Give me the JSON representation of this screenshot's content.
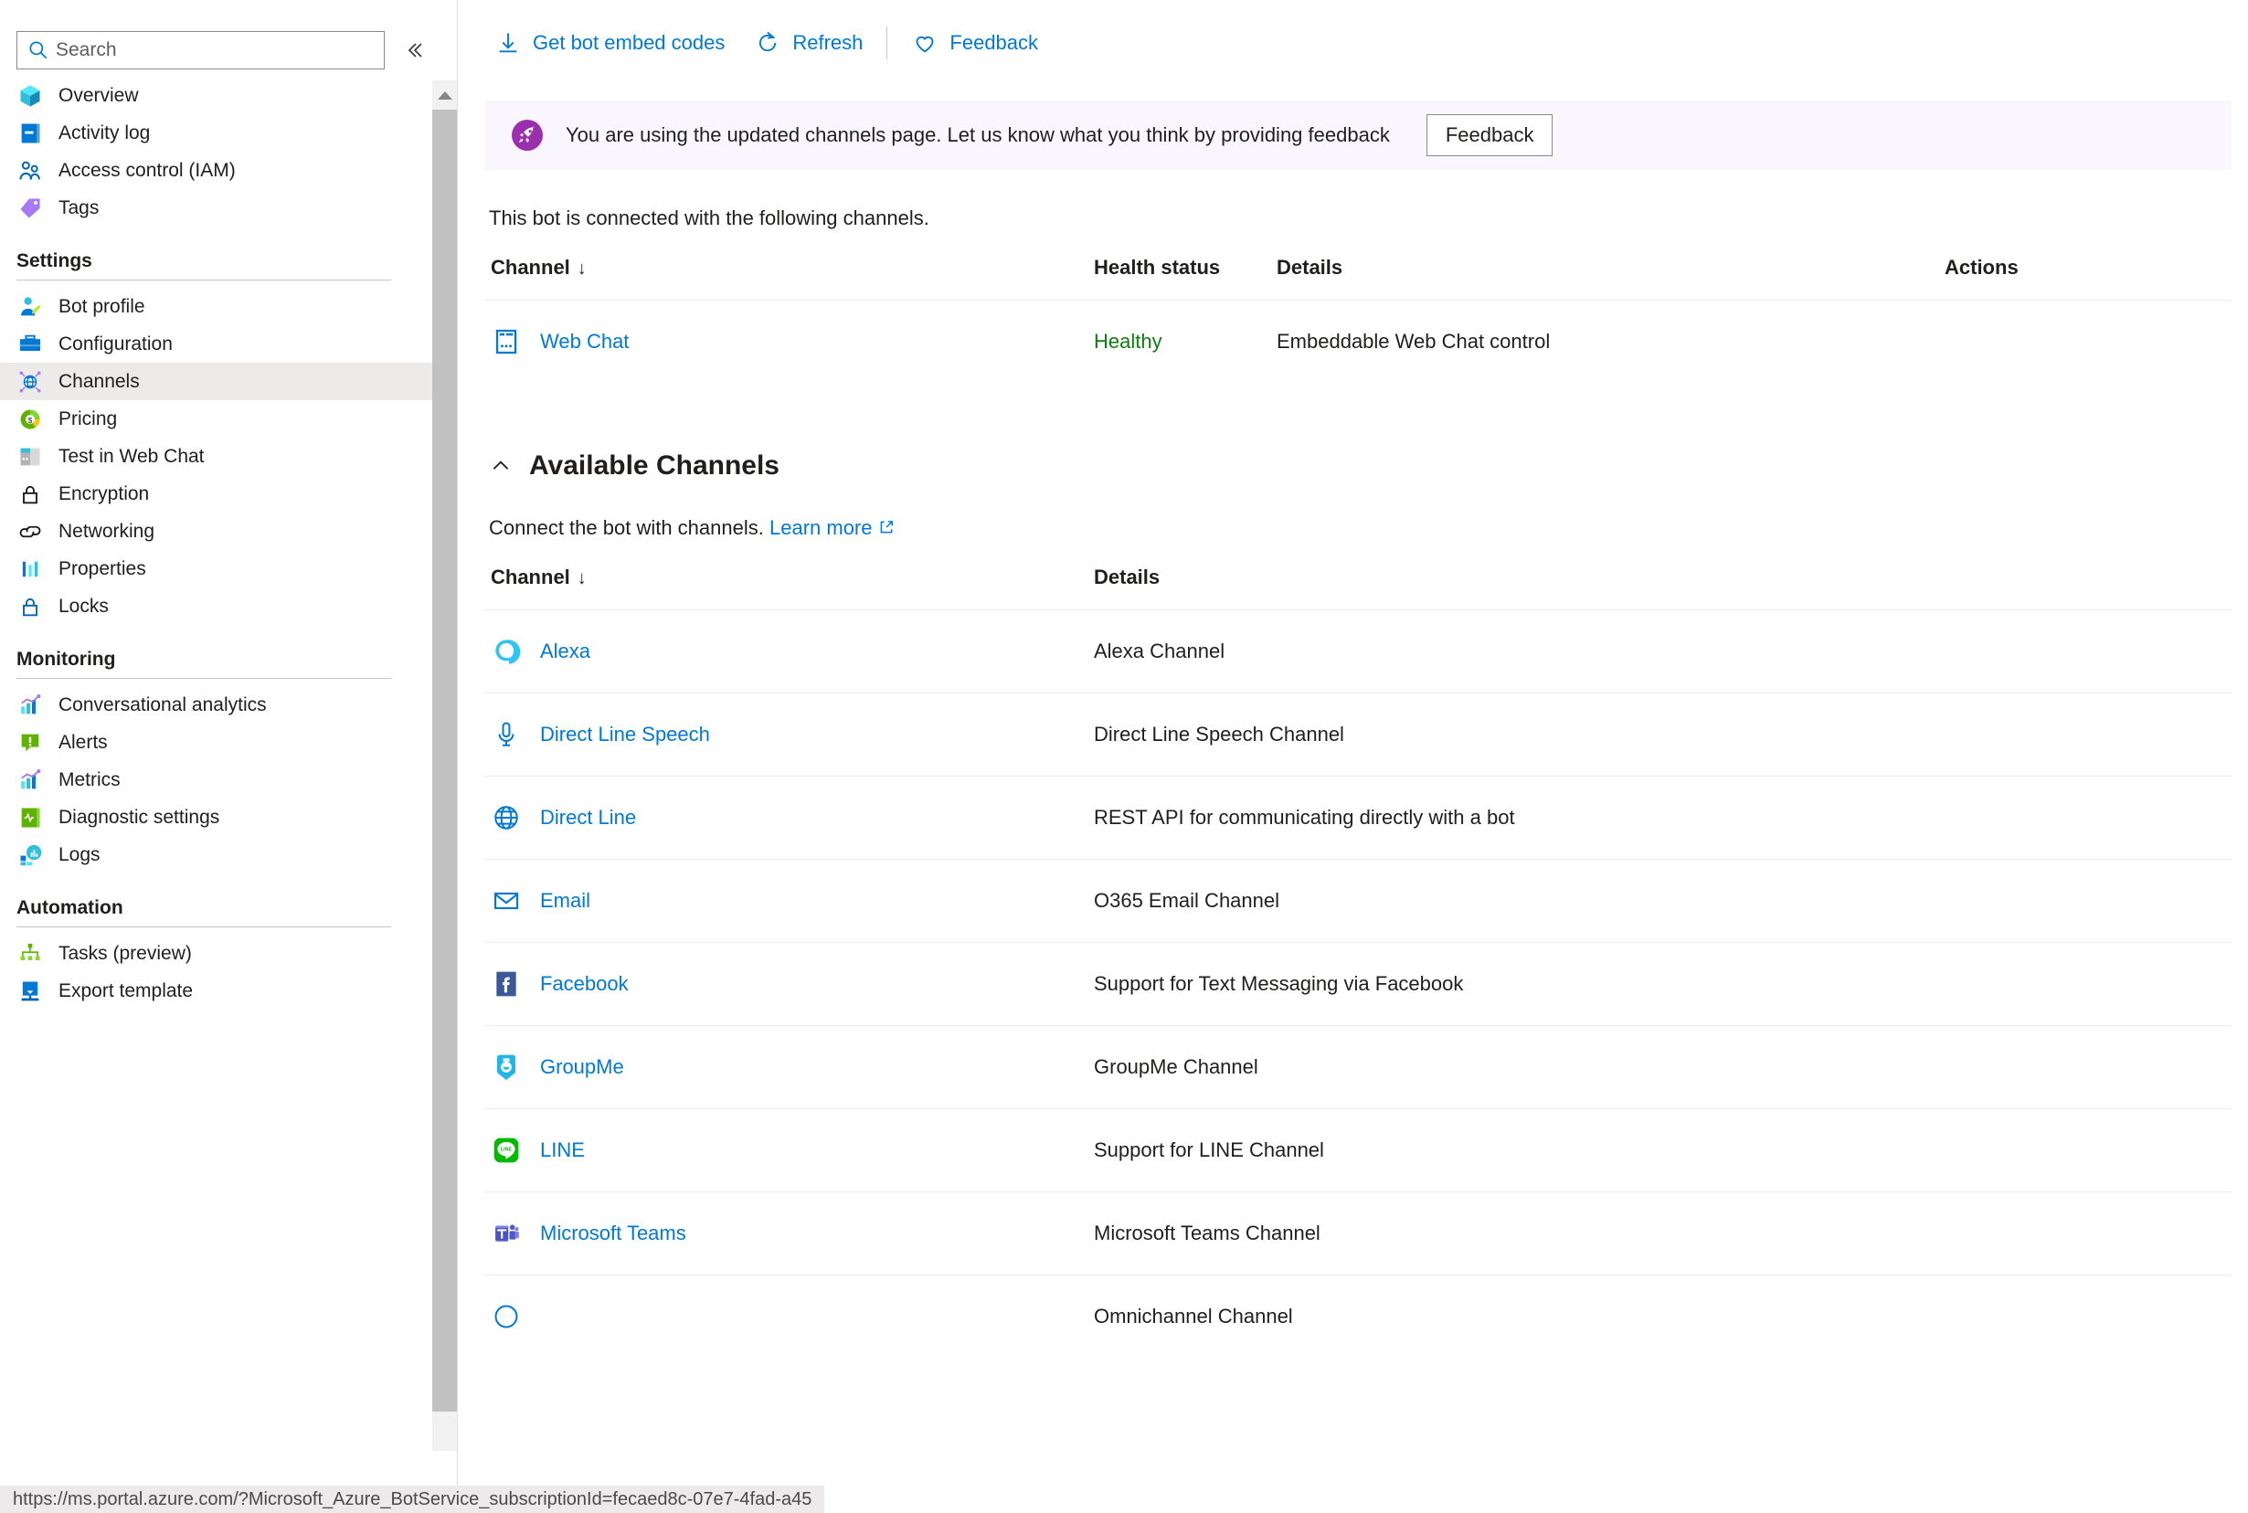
{
  "sidebar": {
    "search": {
      "placeholder": "Search",
      "value": ""
    },
    "collapse_label": "«",
    "top_items": [
      {
        "label": "Overview",
        "icon": "cube-icon"
      },
      {
        "label": "Activity log",
        "icon": "book-icon"
      },
      {
        "label": "Access control (IAM)",
        "icon": "people-icon"
      },
      {
        "label": "Tags",
        "icon": "tag-icon"
      }
    ],
    "groups": [
      {
        "title": "Settings",
        "items": [
          {
            "label": "Bot profile",
            "icon": "person-edit-icon",
            "selected": false
          },
          {
            "label": "Configuration",
            "icon": "briefcase-icon",
            "selected": false
          },
          {
            "label": "Channels",
            "icon": "globe-nodes-icon",
            "selected": true
          },
          {
            "label": "Pricing",
            "icon": "pricing-donut-icon",
            "selected": false
          },
          {
            "label": "Test in Web Chat",
            "icon": "webchat-icon",
            "selected": false
          },
          {
            "label": "Encryption",
            "icon": "lock-gray-icon",
            "selected": false
          },
          {
            "label": "Networking",
            "icon": "link-icon",
            "selected": false
          },
          {
            "label": "Properties",
            "icon": "bars-icon",
            "selected": false
          },
          {
            "label": "Locks",
            "icon": "lock-blue-icon",
            "selected": false
          }
        ]
      },
      {
        "title": "Monitoring",
        "items": [
          {
            "label": "Conversational analytics",
            "icon": "chart-icon",
            "selected": false
          },
          {
            "label": "Alerts",
            "icon": "alert-icon",
            "selected": false
          },
          {
            "label": "Metrics",
            "icon": "chart-icon",
            "selected": false
          },
          {
            "label": "Diagnostic settings",
            "icon": "diagnostic-book-icon",
            "selected": false
          },
          {
            "label": "Logs",
            "icon": "logs-icon",
            "selected": false
          }
        ]
      },
      {
        "title": "Automation",
        "items": [
          {
            "label": "Tasks (preview)",
            "icon": "tasks-tree-icon",
            "selected": false
          },
          {
            "label": "Export template",
            "icon": "export-icon",
            "selected": false
          }
        ]
      }
    ]
  },
  "toolbar": {
    "items": [
      {
        "label": "Get bot embed codes",
        "icon": "download-icon"
      },
      {
        "label": "Refresh",
        "icon": "refresh-icon"
      },
      {
        "label": "Feedback",
        "icon": "heart-icon"
      }
    ]
  },
  "banner": {
    "icon": "rocket-icon",
    "message": "You are using the updated channels page. Let us know what you think by providing feedback",
    "button_label": "Feedback"
  },
  "connected": {
    "intro": "This bot is connected with the following channels.",
    "columns": [
      "Channel",
      "Health status",
      "Details",
      "Actions"
    ],
    "sort_indicator": "↓",
    "rows": [
      {
        "channel": "Web Chat",
        "icon": "webchat-icon",
        "health": "Healthy",
        "details": "Embeddable Web Chat control",
        "actions": ""
      }
    ]
  },
  "available": {
    "title": "Available Channels",
    "collapse_icon": "chevron-up-icon",
    "connect_text": "Connect the bot with channels.",
    "learn_more": "Learn more",
    "columns": [
      "Channel",
      "Details"
    ],
    "sort_indicator": "↓",
    "rows": [
      {
        "channel": "Alexa",
        "icon": "alexa-icon",
        "details": "Alexa Channel"
      },
      {
        "channel": "Direct Line Speech",
        "icon": "mic-icon",
        "details": "Direct Line Speech Channel"
      },
      {
        "channel": "Direct Line",
        "icon": "globe-icon",
        "details": "REST API for communicating directly with a bot"
      },
      {
        "channel": "Email",
        "icon": "envelope-icon",
        "details": "O365 Email Channel"
      },
      {
        "channel": "Facebook",
        "icon": "facebook-icon",
        "details": "Support for Text Messaging via Facebook"
      },
      {
        "channel": "GroupMe",
        "icon": "groupme-icon",
        "details": "GroupMe Channel"
      },
      {
        "channel": "LINE",
        "icon": "line-icon",
        "details": "Support for LINE Channel"
      },
      {
        "channel": "Microsoft Teams",
        "icon": "teams-icon",
        "details": "Microsoft Teams Channel"
      },
      {
        "channel": "",
        "icon": "omnichannel-icon",
        "details": "Omnichannel Channel"
      }
    ]
  },
  "statusbar": {
    "url": "https://ms.portal.azure.com/?Microsoft_Azure_BotService_subscriptionId=fecaed8c-07e7-4fad-a45"
  },
  "colors": {
    "link": "#0078d4",
    "healthy": "#107c10",
    "banner_bg": "#faf6fd",
    "rocket_purple": "#9b2fae",
    "selected_nav": "#edebe9"
  }
}
